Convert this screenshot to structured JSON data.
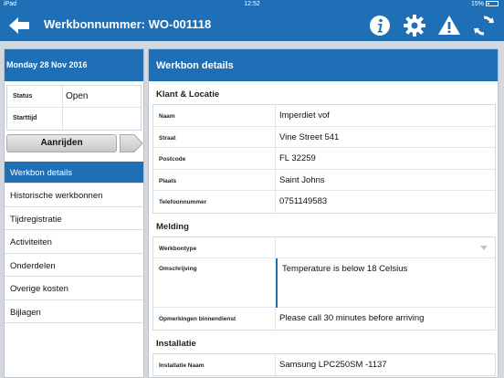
{
  "statusbar": {
    "device": "iPad",
    "time": "12:52",
    "battery": "15%"
  },
  "navbar": {
    "title": "Werkbonnummer: WO-001118",
    "icons": [
      "back-arrow-icon",
      "info-icon",
      "gear-icon",
      "warning-icon",
      "refresh-icon"
    ]
  },
  "left": {
    "date": "Monday 28 Nov 2016",
    "status_label": "Status",
    "status_value": "Open",
    "starttijd_label": "Starttijd",
    "starttijd_value": "",
    "aanrijden_label": "Aanrijden",
    "nav": [
      {
        "label": "Werkbon details"
      },
      {
        "label": "Historische werkbonnen"
      },
      {
        "label": "Tijdregistratie"
      },
      {
        "label": "Activiteiten"
      },
      {
        "label": "Onderdelen"
      },
      {
        "label": "Overige kosten"
      },
      {
        "label": "Bijlagen"
      }
    ]
  },
  "right": {
    "header": "Werkbon details",
    "klant": {
      "title": "Klant & Locatie",
      "rows": [
        {
          "label": "Naam",
          "value": "Imperdiet vof"
        },
        {
          "label": "Straat",
          "value": "Vine Street 541"
        },
        {
          "label": "Postcode",
          "value": "FL 32259"
        },
        {
          "label": "Plaats",
          "value": "Saint Johns"
        },
        {
          "label": "Telefoonnummer",
          "value": "0751149583"
        }
      ]
    },
    "melding": {
      "title": "Melding",
      "werkbontype_label": "Werkbontype",
      "werkbontype_value": "",
      "omschrijving_label": "Omschrijving",
      "omschrijving_value": "Temperature is below 18 Celsius",
      "opmerkingen_label": "Opmerkingen binnendienst",
      "opmerkingen_value": "Please call 30 minutes before arriving"
    },
    "installatie": {
      "title": "Installatie",
      "naam_label": "Installatie Naam",
      "naam_value": "Samsung LPC250SM -1137"
    }
  },
  "colors": {
    "primary": "#1e6fb5",
    "background": "#d4d8dc"
  }
}
